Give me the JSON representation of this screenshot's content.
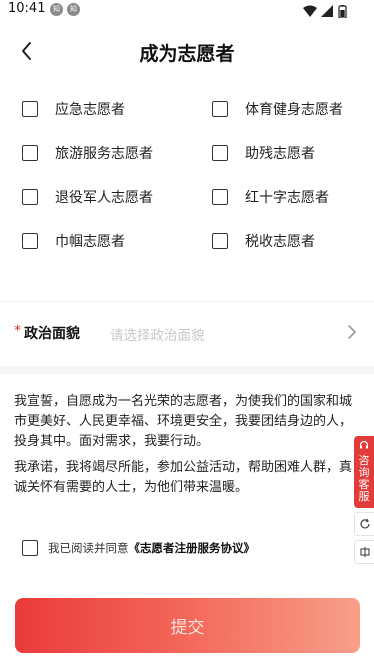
{
  "status_bar": {
    "time": "10:41",
    "badges": [
      "知",
      "知"
    ]
  },
  "header": {
    "title": "成为志愿者"
  },
  "volunteer_types": [
    "应急志愿者",
    "体育健身志愿者",
    "旅游服务志愿者",
    "助残志愿者",
    "退役军人志愿者",
    "红十字志愿者",
    "巾帼志愿者",
    "税收志愿者"
  ],
  "political": {
    "required": "*",
    "label": "政治面貌",
    "placeholder": "请选择政治面貌"
  },
  "pledge": [
    "我宣誓，自愿成为一名光荣的志愿者，为使我们的国家和城市更美好、人民更幸福、环境更安全，我要团结身边的人，投身其中。面对需求，我要行动。",
    "我承诺，我将竭尽所能，参加公益活动，帮助困难人群，真诚关怀有需要的人士，为他们带来温暖。"
  ],
  "side_tools": {
    "consult": "咨询客服"
  },
  "agreement": {
    "text": "我已阅读并同意",
    "link": "《志愿者注册服务协议》"
  },
  "submit": {
    "label": "提交"
  },
  "colors": {
    "accent": "#e33a3a",
    "required": "#e03131"
  }
}
